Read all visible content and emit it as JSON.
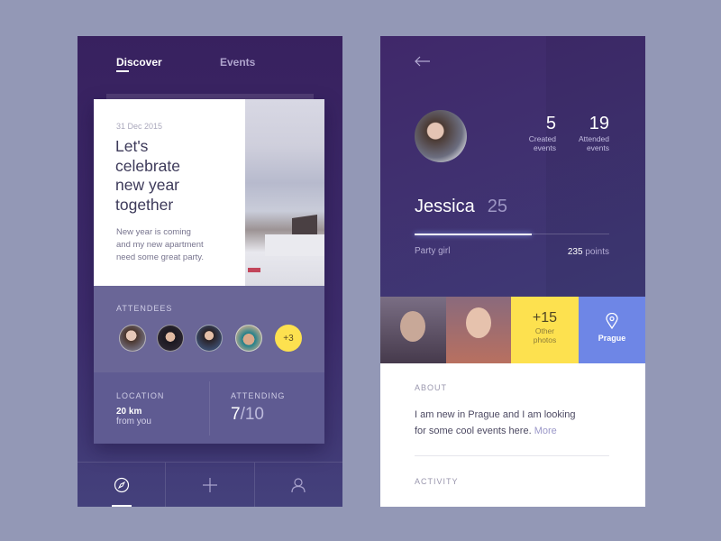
{
  "discover": {
    "tabs": [
      {
        "label": "Discover",
        "active": true
      },
      {
        "label": "Events",
        "active": false
      }
    ],
    "card": {
      "date": "31 Dec 2015",
      "title_lines": [
        "Let's",
        "celebrate",
        "new year",
        "together"
      ],
      "description_lines": [
        "New year is coming",
        "and my new apartment",
        "need some great party."
      ],
      "attendees_label": "ATTENDEES",
      "attendees_more": "+3",
      "location_label": "LOCATION",
      "location_value": "20 km",
      "location_sub": "from you",
      "attending_label": "ATTENDING",
      "attending_count": "7",
      "attending_total": "/10"
    },
    "nav": [
      {
        "icon": "compass-icon",
        "active": true
      },
      {
        "icon": "plus-icon"
      },
      {
        "icon": "user-icon"
      }
    ]
  },
  "profile": {
    "back_icon": "arrow-left-icon",
    "stats": [
      {
        "value": "5",
        "label1": "Created",
        "label2": "events"
      },
      {
        "value": "19",
        "label1": "Attended",
        "label2": "events"
      }
    ],
    "name": "Jessica",
    "age": "25",
    "progress": 0.6,
    "title": "Party girl",
    "points": "235",
    "points_label": "points",
    "photos_more": "+15",
    "photos_more_label1": "Other",
    "photos_more_label2": "photos",
    "location": "Prague",
    "about_label": "ABOUT",
    "about_lines": [
      "I am new in Prague and I am looking",
      "for some cool events here."
    ],
    "more_link": "More",
    "activity_label": "ACTIVITY"
  },
  "colors": {
    "accent_yellow": "#fde14f",
    "location_blue": "#6e86e6",
    "purple": "#3a2463"
  }
}
